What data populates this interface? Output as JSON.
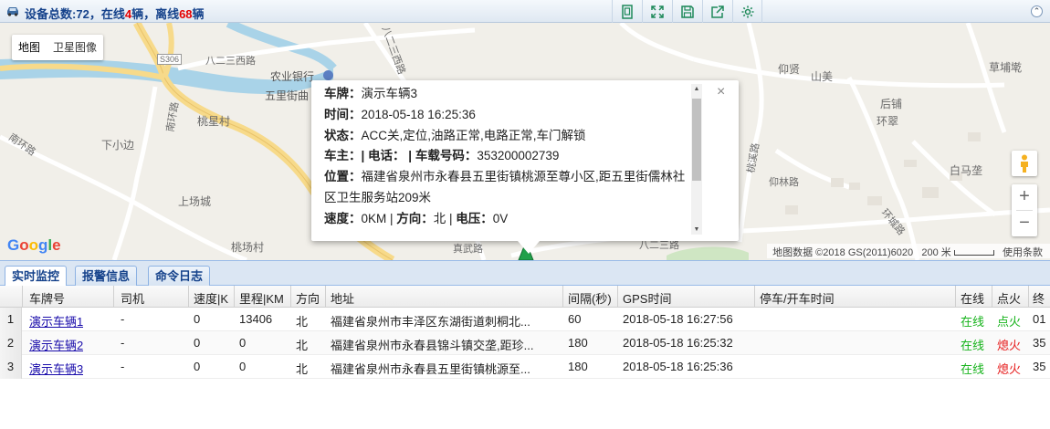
{
  "header": {
    "summary_prefix": "设备总数:",
    "total": "72",
    "online_prefix": "，在线",
    "online": "4",
    "online_suffix": "辆，离线",
    "offline": "68",
    "offline_suffix": "辆"
  },
  "toolbar": {
    "icons": [
      "fit-icon",
      "fullscreen-icon",
      "save-icon",
      "export-icon",
      "settings-icon"
    ]
  },
  "map": {
    "type_buttons": [
      "地图",
      "卫星图像"
    ],
    "places": {
      "agri_bank": "农业银行",
      "wuli": "五里街曲",
      "taoxing": "桃星村",
      "xiaqiu": "下小边",
      "shangchang": "上场城",
      "taochang": "桃场村",
      "yangxian": "仰贤",
      "shanmei": "山美",
      "houpu": "后铺",
      "huancui": "环翠",
      "caopu": "草埔墘",
      "baima": "白马垄",
      "zhenwu": "真武路"
    },
    "roads": {
      "bayi": "八二三西路",
      "bayi2": "八二三西路",
      "s306": "S306",
      "nanhuan": "南环路",
      "nanhuan2": "南环路",
      "taoxi": "桃溪路",
      "xiyuan": "仰林路",
      "huancheng": "环城路",
      "liusan": "八二三路"
    },
    "zoom_in": "+",
    "zoom_out": "−",
    "attribution": "地图数据 ©2018 GS(2011)6020",
    "scale": "200 米",
    "terms": "使用条款",
    "google": "Google"
  },
  "popup": {
    "plate_label": "车牌：",
    "plate": "演示车辆3",
    "time_label": "时间：",
    "time": "2018-05-18 16:25:36",
    "status_label": "状态：",
    "status": "ACC关,定位,油路正常,电路正常,车门解锁",
    "owner_label": "车主：",
    "owner_sep": "| ",
    "phone_label": "电话：",
    "device_label": "| 车载号码：",
    "device": "353200002739",
    "location_label": "位置：",
    "location": "福建省泉州市永春县五里街镇桃源至尊小区,距五里街儒林社区卫生服务站209米",
    "speed_label": "速度：",
    "speed": "0KM",
    "dir_label": "方向：",
    "dir": "北",
    "volt_label": "电压：",
    "volt": "0V",
    "close": "×"
  },
  "tabs": [
    "实时监控",
    "报警信息",
    "命令日志"
  ],
  "table": {
    "columns": [
      "车牌号",
      "司机",
      "速度|K",
      "里程|KM",
      "方向",
      "地址",
      "间隔(秒)",
      "GPS时间",
      "停车/开车时间",
      "在线",
      "点火",
      "终"
    ],
    "rows": [
      {
        "n": "1",
        "plate": "演示车辆1",
        "driver": "-",
        "speed": "0",
        "mileage": "13406",
        "dir": "北",
        "addr": "福建省泉州市丰泽区东湖街道刺桐北...",
        "interval": "60",
        "gps": "2018-05-18 16:27:56",
        "park": "",
        "online": "在线",
        "ign": "点火",
        "ign_on": true,
        "end": "01"
      },
      {
        "n": "2",
        "plate": "演示车辆2",
        "driver": "-",
        "speed": "0",
        "mileage": "0",
        "dir": "北",
        "addr": "福建省泉州市永春县锦斗镇交垄,距珍...",
        "interval": "180",
        "gps": "2018-05-18 16:25:32",
        "park": "",
        "online": "在线",
        "ign": "熄火",
        "ign_on": false,
        "end": "35"
      },
      {
        "n": "3",
        "plate": "演示车辆3",
        "driver": "-",
        "speed": "0",
        "mileage": "0",
        "dir": "北",
        "addr": "福建省泉州市永春县五里街镇桃源至...",
        "interval": "180",
        "gps": "2018-05-18 16:25:36",
        "park": "",
        "online": "在线",
        "ign": "熄火",
        "ign_on": false,
        "end": "35"
      }
    ]
  },
  "colors": {
    "header_text": "#15428b",
    "alert_red": "#e60000",
    "online_green": "#16b31b",
    "link_blue": "#1a0dab"
  }
}
